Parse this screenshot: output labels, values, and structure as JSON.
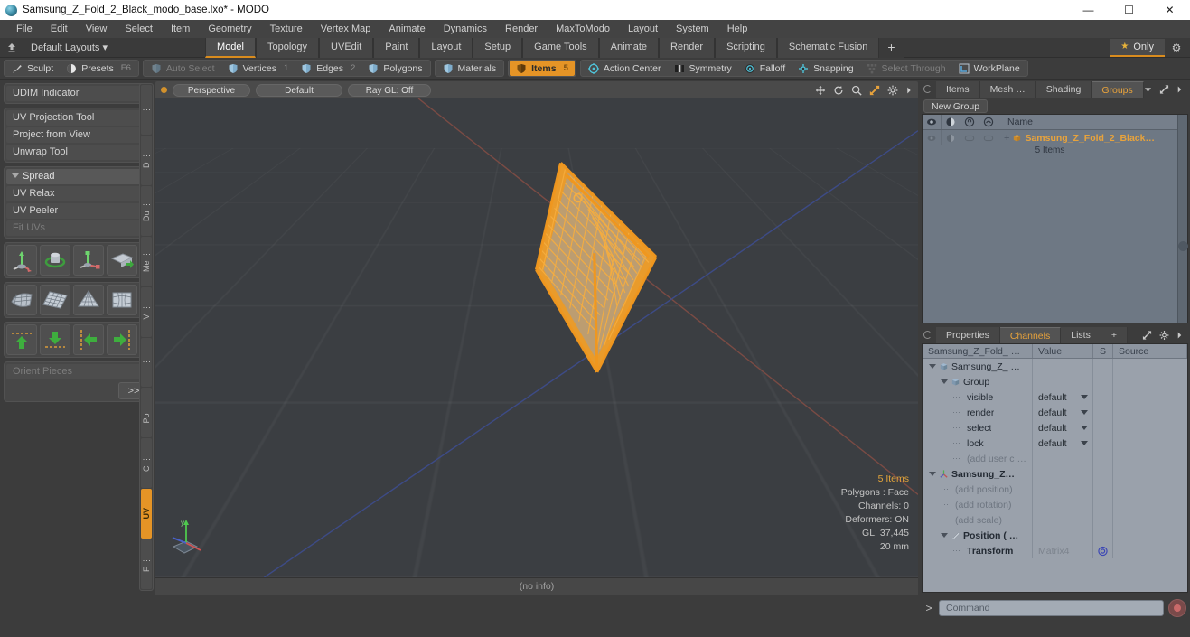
{
  "window": {
    "title": "Samsung_Z_Fold_2_Black_modo_base.lxo* - MODO",
    "app_icon": "modo-sphere-icon",
    "controls": {
      "minimize": "—",
      "maximize": "☐",
      "close": "✕"
    }
  },
  "menubar": {
    "items": [
      "File",
      "Edit",
      "View",
      "Select",
      "Item",
      "Geometry",
      "Texture",
      "Vertex Map",
      "Animate",
      "Dynamics",
      "Render",
      "MaxToModo",
      "Layout",
      "System",
      "Help"
    ]
  },
  "layout_row": {
    "default_layouts_label": "Default Layouts",
    "tabs": [
      {
        "label": "Model",
        "active": true
      },
      {
        "label": "Topology",
        "active": false
      },
      {
        "label": "UVEdit",
        "active": false
      },
      {
        "label": "Paint",
        "active": false
      },
      {
        "label": "Layout",
        "active": false
      },
      {
        "label": "Setup",
        "active": false
      },
      {
        "label": "Game Tools",
        "active": false
      },
      {
        "label": "Animate",
        "active": false
      },
      {
        "label": "Render",
        "active": false
      },
      {
        "label": "Scripting",
        "active": false
      },
      {
        "label": "Schematic Fusion",
        "active": false
      }
    ],
    "add_tab_label": "+",
    "only_label": "Only",
    "star_glyph": "★",
    "gear_glyph": "⚙"
  },
  "modebar": {
    "group_left": [
      {
        "label": "Sculpt",
        "icon": "brush-icon",
        "state": "normal",
        "hint": ""
      },
      {
        "label": "Presets",
        "icon": "sphere-icon",
        "state": "normal",
        "hint": "F6"
      }
    ],
    "group_select": [
      {
        "label": "Auto Select",
        "icon": "shield-icon",
        "state": "dim",
        "hint": ""
      },
      {
        "label": "Vertices",
        "icon": "shield-icon",
        "state": "normal",
        "hint": "1"
      },
      {
        "label": "Edges",
        "icon": "shield-icon",
        "state": "normal",
        "hint": "2"
      },
      {
        "label": "Polygons",
        "icon": "shield-icon",
        "state": "normal",
        "hint": ""
      }
    ],
    "group_materials": [
      {
        "label": "Materials",
        "icon": "shield-icon",
        "state": "normal",
        "hint": ""
      }
    ],
    "group_items": [
      {
        "label": "Items",
        "icon": "shield-icon",
        "state": "active",
        "hint": "5"
      }
    ],
    "group_right": [
      {
        "label": "Action Center",
        "icon": "target-icon",
        "state": "normal",
        "hint": ""
      },
      {
        "label": "Symmetry",
        "icon": "symmetry-icon",
        "state": "normal",
        "hint": ""
      },
      {
        "label": "Falloff",
        "icon": "falloff-icon",
        "state": "normal",
        "hint": ""
      },
      {
        "label": "Snapping",
        "icon": "snap-icon",
        "state": "normal",
        "hint": ""
      },
      {
        "label": "Select Through",
        "icon": "select-through-icon",
        "state": "dim",
        "hint": ""
      },
      {
        "label": "WorkPlane",
        "icon": "workplane-icon",
        "state": "normal",
        "hint": ""
      }
    ]
  },
  "left_panel": {
    "group1": [
      {
        "label": "UDIM Indicator",
        "dim": false
      }
    ],
    "group2": [
      {
        "label": "UV Projection Tool",
        "dim": false
      },
      {
        "label": "Project from View",
        "dim": false
      },
      {
        "label": "Unwrap Tool",
        "dim": false
      }
    ],
    "group3_header": "Spread",
    "group3": [
      {
        "label": "UV Relax",
        "dim": false
      },
      {
        "label": "UV Peeler",
        "dim": false
      },
      {
        "label": "Fit UVs",
        "dim": true
      }
    ],
    "icon_row_1": [
      "uv-move-icon",
      "uv-rotate-icon",
      "uv-scale-icon",
      "uv-flip-icon"
    ],
    "icon_row_2": [
      "uv-fit-icon",
      "uv-grid-icon",
      "uv-cone-icon",
      "uv-sphere-icon"
    ],
    "icon_row_3": [
      "align-up-icon",
      "align-down-icon",
      "align-left-icon",
      "align-right-icon"
    ],
    "orient_label": "Orient Pieces",
    "more_label": ">>",
    "vertical_tabs": [
      {
        "label": "⋮",
        "active": false
      },
      {
        "label": "D ⋮",
        "active": false
      },
      {
        "label": "Du ⋮",
        "active": false
      },
      {
        "label": "Me ⋮",
        "active": false
      },
      {
        "label": "V ⋮",
        "active": false
      },
      {
        "label": "⋮",
        "active": false
      },
      {
        "label": "Po ⋮",
        "active": false
      },
      {
        "label": "C ⋮",
        "active": false
      },
      {
        "label": "UV",
        "active": true
      },
      {
        "label": "F ⋮",
        "active": false
      }
    ]
  },
  "viewport": {
    "mode_label": "Perspective",
    "shading_label": "Default",
    "raygl_label": "Ray GL: Off",
    "header_icons": [
      "move-icon",
      "rotate-icon",
      "zoom-icon",
      "maximize-icon",
      "gear-icon",
      "chevron-right-icon"
    ],
    "info": {
      "items": "5 Items",
      "polygons": "Polygons : Face",
      "channels": "Channels: 0",
      "deformers": "Deformers: ON",
      "gl": "GL: 37,445",
      "scale": "20 mm"
    },
    "axis_label_y": "y",
    "status_text": "(no info)",
    "accent_color": "#e8a33c",
    "selection_color": "#f5a623"
  },
  "right_panel": {
    "top_tabs": [
      {
        "label": "Items",
        "active": false
      },
      {
        "label": "Mesh …",
        "active": false
      },
      {
        "label": "Shading",
        "active": false
      },
      {
        "label": "Groups",
        "active": true
      }
    ],
    "new_group_label": "New Group",
    "item_list": {
      "columns": [
        "visibility-icon",
        "render-icon",
        "lock-icon",
        "select-icon",
        "Name"
      ],
      "rows": [
        {
          "name": "Samsung_Z_Fold_2_Black…",
          "sub": "5 Items",
          "selected": true
        }
      ]
    },
    "bottom_tabs": [
      {
        "label": "Properties",
        "active": false
      },
      {
        "label": "Channels",
        "active": true
      },
      {
        "label": "Lists",
        "active": false
      },
      {
        "label": "+",
        "active": false
      }
    ],
    "channels": {
      "headers": [
        "Samsung_Z_Fold_ …",
        "Value",
        "S",
        "Source"
      ],
      "rows": [
        {
          "indent": 0,
          "tri": true,
          "icon": "group-icon",
          "label": "Samsung_Z_ …",
          "bold": false,
          "dim": false,
          "value": "",
          "value_dim": false,
          "dropdown": false,
          "s": ""
        },
        {
          "indent": 1,
          "tri": true,
          "icon": "group-icon",
          "label": "Group",
          "bold": false,
          "dim": false,
          "value": "",
          "value_dim": false,
          "dropdown": false,
          "s": ""
        },
        {
          "indent": 2,
          "tri": false,
          "icon": "",
          "label": "visible",
          "bold": false,
          "dim": false,
          "value": "default",
          "value_dim": false,
          "dropdown": true,
          "s": ""
        },
        {
          "indent": 2,
          "tri": false,
          "icon": "",
          "label": "render",
          "bold": false,
          "dim": false,
          "value": "default",
          "value_dim": false,
          "dropdown": true,
          "s": ""
        },
        {
          "indent": 2,
          "tri": false,
          "icon": "",
          "label": "select",
          "bold": false,
          "dim": false,
          "value": "default",
          "value_dim": false,
          "dropdown": true,
          "s": ""
        },
        {
          "indent": 2,
          "tri": false,
          "icon": "",
          "label": "lock",
          "bold": false,
          "dim": false,
          "value": "default",
          "value_dim": false,
          "dropdown": true,
          "s": ""
        },
        {
          "indent": 2,
          "tri": false,
          "icon": "",
          "label": "(add user c …",
          "bold": false,
          "dim": true,
          "value": "",
          "value_dim": false,
          "dropdown": false,
          "s": ""
        },
        {
          "indent": 0,
          "tri": true,
          "icon": "locator-icon",
          "label": "Samsung_Z…",
          "bold": true,
          "dim": false,
          "value": "",
          "value_dim": false,
          "dropdown": false,
          "s": ""
        },
        {
          "indent": 1,
          "tri": false,
          "icon": "",
          "label": "(add position)",
          "bold": false,
          "dim": true,
          "value": "",
          "value_dim": false,
          "dropdown": false,
          "s": ""
        },
        {
          "indent": 1,
          "tri": false,
          "icon": "",
          "label": "(add rotation)",
          "bold": false,
          "dim": true,
          "value": "",
          "value_dim": false,
          "dropdown": false,
          "s": ""
        },
        {
          "indent": 1,
          "tri": false,
          "icon": "",
          "label": "(add scale)",
          "bold": false,
          "dim": true,
          "value": "",
          "value_dim": false,
          "dropdown": false,
          "s": ""
        },
        {
          "indent": 1,
          "tri": true,
          "icon": "position-icon",
          "label": "Position ( …",
          "bold": true,
          "dim": false,
          "value": "",
          "value_dim": false,
          "dropdown": false,
          "s": ""
        },
        {
          "indent": 2,
          "tri": false,
          "icon": "",
          "label": "Transform",
          "bold": true,
          "dim": false,
          "value": "Matrix4",
          "value_dim": true,
          "dropdown": false,
          "s": "target-icon"
        }
      ]
    }
  },
  "bottom": {
    "prompt": "&gt;",
    "command_placeholder": "Command",
    "record_icon": "record-icon"
  }
}
